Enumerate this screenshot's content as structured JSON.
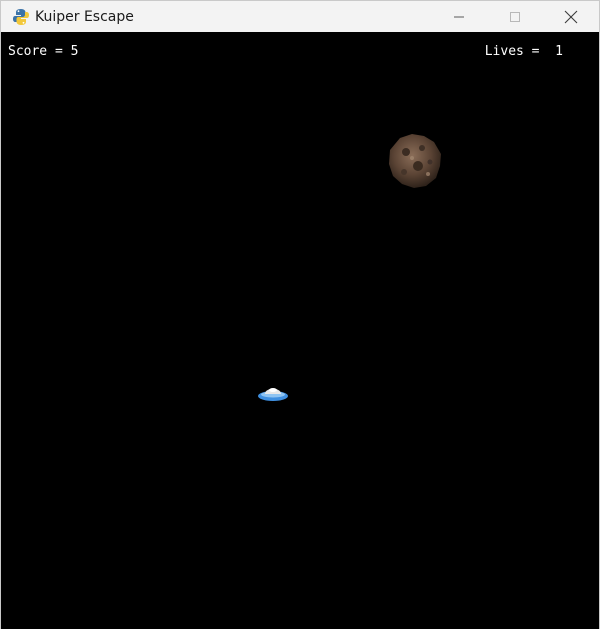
{
  "window": {
    "title": "Kuiper Escape",
    "app_icon": "python-icon"
  },
  "controls": {
    "minimize_icon": "minimize-icon",
    "maximize_icon": "maximize-icon",
    "close_icon": "close-icon"
  },
  "hud": {
    "score_text": "Score = 5",
    "lives_text": "Lives =  1"
  },
  "colors": {
    "background": "#000000",
    "hud_text": "#ffffff",
    "ship_saucer": "#3f8fe0",
    "ship_dome": "#e8e8e8",
    "asteroid": "#5a4334"
  },
  "sprites": {
    "asteroid_icon": "asteroid-icon",
    "player_icon": "ufo-icon"
  }
}
